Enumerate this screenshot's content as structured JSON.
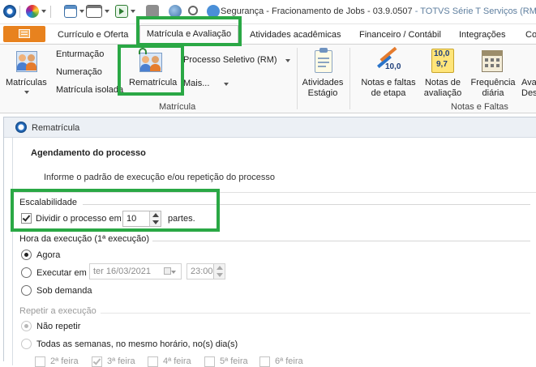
{
  "window": {
    "title": "Segurança - Fracionamento de Jobs - 03.9.0507",
    "title_suffix": "- TOTVS Série T Serviços (RM) A"
  },
  "quick_access": {
    "icons": [
      "app-logo-icon",
      "color-wheel-icon",
      "window-icon",
      "layout-icon",
      "run-icon",
      "back-icon",
      "globe-icon",
      "zoom-icon",
      "info-icon"
    ]
  },
  "tabs": {
    "file_icon": "menu-icon",
    "items": [
      {
        "label": "Currículo e Oferta"
      },
      {
        "label": "Matrícula e Avaliação"
      },
      {
        "label": "Atividades acadêmicas"
      },
      {
        "label": "Financeiro / Contábil"
      },
      {
        "label": "Integrações"
      },
      {
        "label": "Co"
      }
    ]
  },
  "ribbon": {
    "matriculas": "Matrículas",
    "enturmacao": "Enturmação",
    "numeracao": "Numeração",
    "matricula_isolada": "Matrícula isolada",
    "rematricula": "Rematrícula",
    "processo_seletivo": "Processo Seletivo (RM)",
    "mais": "Mais...",
    "atividades_estagio_1": "Atividades",
    "atividades_estagio_2": "Estágio",
    "notas_faltas_etapa_1": "Notas e faltas",
    "notas_faltas_etapa_2": "de etapa",
    "notas_avaliacao_1": "Notas de",
    "notas_avaliacao_2": "avaliação",
    "frequencia_diaria_1": "Frequência",
    "frequencia_diaria_2": "diária",
    "ava_1": "Ava",
    "ava_2": "Des",
    "group_matricula": "Matrícula",
    "group_notas_faltas": "Notas e Faltas",
    "icon_notas_etapa_value": "10,0",
    "icon_notas_avaliacao_top": "10,0",
    "icon_notas_avaliacao_bottom": "9,7"
  },
  "panel": {
    "title": "Rematrícula",
    "heading": "Agendamento do processo",
    "subtext": "Informe o padrão de execução e/ou repetição do processo",
    "escalabilidade": {
      "legend": "Escalabilidade",
      "checkbox_label": "Dividir o processo em",
      "checked": true,
      "parts_value": "10",
      "parts_suffix": "partes."
    },
    "hora_execucao": {
      "legend": "Hora da execução (1ª execução)",
      "agora": "Agora",
      "executar_em": "Executar em",
      "date_value": "ter  16/03/2021",
      "time_value": "23:00",
      "sob_demanda": "Sob demanda",
      "selected": "agora"
    },
    "repetir": {
      "legend": "Repetir a execução",
      "nao_repetir": "Não repetir",
      "todas_semanas": "Todas as semanas, no mesmo horário, no(s) dia(s)",
      "selected": "nao_repetir",
      "days": [
        {
          "label": "2ª feira",
          "checked": false
        },
        {
          "label": "3ª feira",
          "checked": true
        },
        {
          "label": "4ª feira",
          "checked": false
        },
        {
          "label": "5ª feira",
          "checked": false
        },
        {
          "label": "6ª feira",
          "checked": false
        }
      ]
    }
  },
  "colors": {
    "highlight": "#2aa845",
    "file_tab": "#e8821e",
    "accent_blue": "#2a74c9"
  }
}
